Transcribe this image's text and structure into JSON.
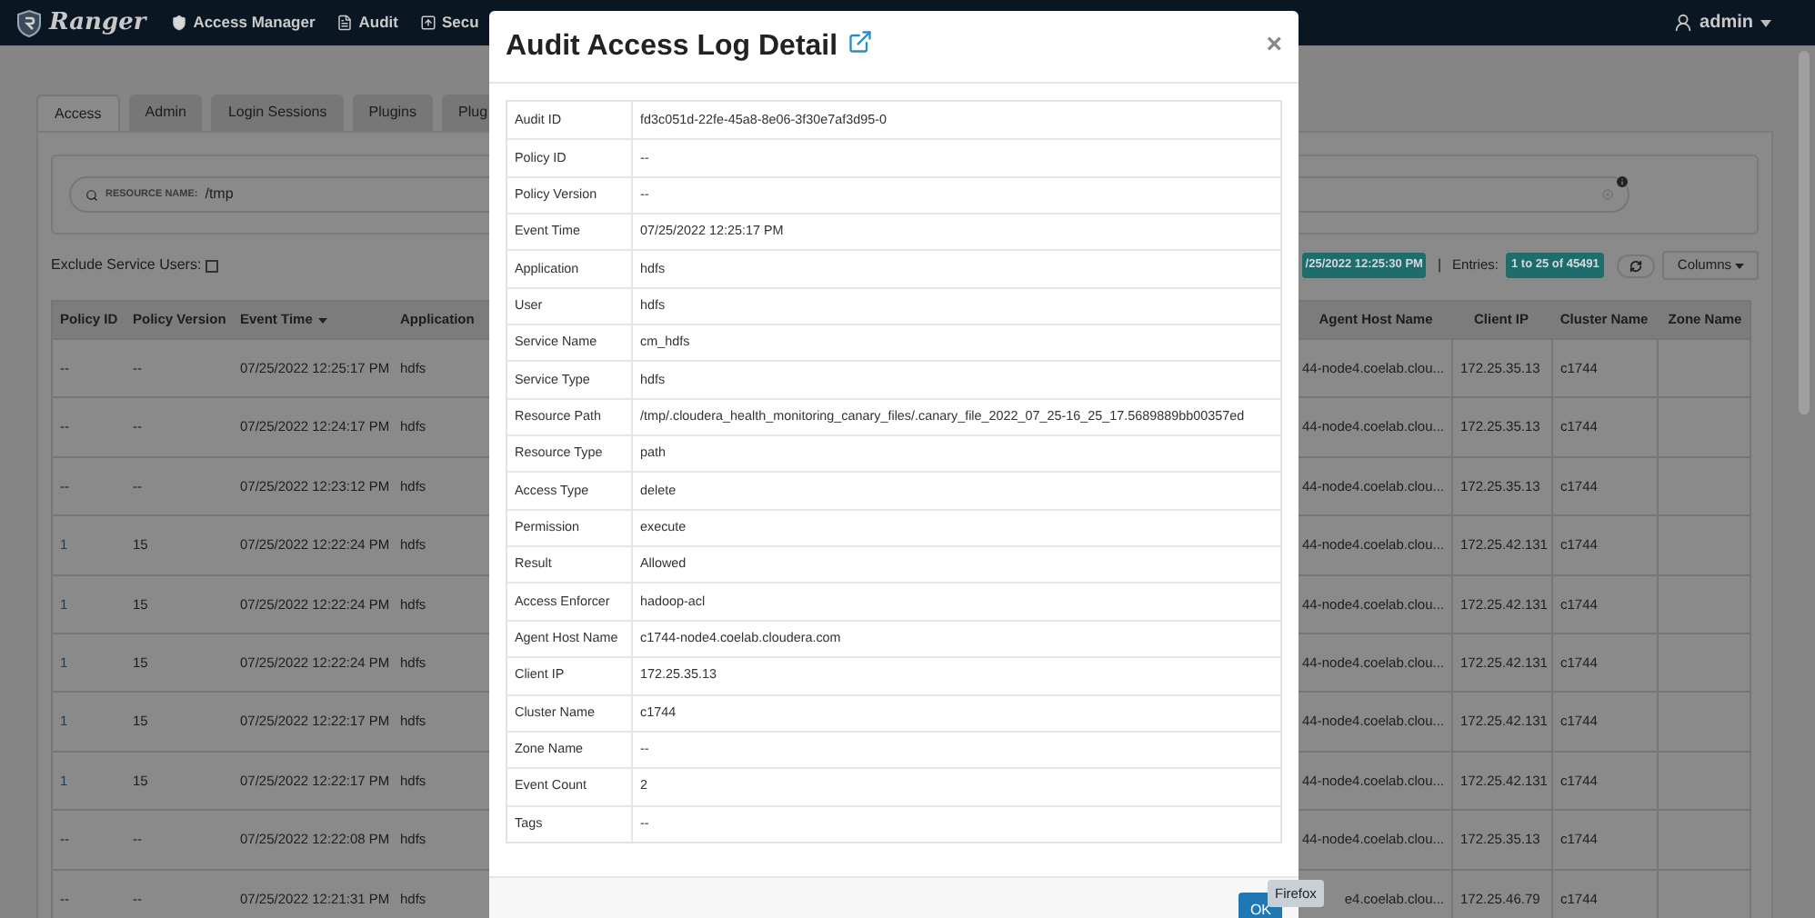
{
  "nav": {
    "brand": "Ranger",
    "items": [
      {
        "label": "Access Manager"
      },
      {
        "label": "Audit"
      },
      {
        "label": "Secu"
      }
    ],
    "user": "admin"
  },
  "tabs": [
    {
      "label": "Access",
      "selected": true
    },
    {
      "label": "Admin",
      "selected": false
    },
    {
      "label": "Login Sessions",
      "selected": false
    },
    {
      "label": "Plugins",
      "selected": false
    },
    {
      "label": "Plug",
      "selected": false
    }
  ],
  "search": {
    "facet": "RESOURCE NAME:",
    "value": "/tmp"
  },
  "exclude_service_users": {
    "label": "Exclude Service Users:",
    "checked": false
  },
  "toolbar": {
    "last_updated": "/25/2022 12:25:30 PM",
    "separator": "|",
    "entries_label": "Entries:",
    "entries": "1 to 25 of 45491",
    "columns_button": "Columns"
  },
  "table": {
    "left_columns": [
      "Policy ID",
      "Policy Version",
      "Event Time",
      "Application"
    ],
    "right_columns": [
      "Agent Host Name",
      "Client IP",
      "Cluster Name",
      "Zone Name"
    ],
    "rows": [
      {
        "policy_id": "--",
        "policy_link": false,
        "policy_version": "--",
        "event_time": "07/25/2022 12:25:17 PM",
        "application": "hdfs",
        "agent_host": "44-node4.coelab.clou...",
        "client_ip": "172.25.35.13",
        "cluster": "c1744"
      },
      {
        "policy_id": "--",
        "policy_link": false,
        "policy_version": "--",
        "event_time": "07/25/2022 12:24:17 PM",
        "application": "hdfs",
        "agent_host": "44-node4.coelab.clou...",
        "client_ip": "172.25.35.13",
        "cluster": "c1744"
      },
      {
        "policy_id": "--",
        "policy_link": false,
        "policy_version": "--",
        "event_time": "07/25/2022 12:23:12 PM",
        "application": "hdfs",
        "agent_host": "44-node4.coelab.clou...",
        "client_ip": "172.25.35.13",
        "cluster": "c1744"
      },
      {
        "policy_id": "1",
        "policy_link": true,
        "policy_version": "15",
        "event_time": "07/25/2022 12:22:24 PM",
        "application": "hdfs",
        "agent_host": "44-node4.coelab.clou...",
        "client_ip": "172.25.42.131",
        "cluster": "c1744"
      },
      {
        "policy_id": "1",
        "policy_link": true,
        "policy_version": "15",
        "event_time": "07/25/2022 12:22:24 PM",
        "application": "hdfs",
        "agent_host": "44-node4.coelab.clou...",
        "client_ip": "172.25.42.131",
        "cluster": "c1744"
      },
      {
        "policy_id": "1",
        "policy_link": true,
        "policy_version": "15",
        "event_time": "07/25/2022 12:22:24 PM",
        "application": "hdfs",
        "agent_host": "44-node4.coelab.clou...",
        "client_ip": "172.25.42.131",
        "cluster": "c1744"
      },
      {
        "policy_id": "1",
        "policy_link": true,
        "policy_version": "15",
        "event_time": "07/25/2022 12:22:17 PM",
        "application": "hdfs",
        "agent_host": "44-node4.coelab.clou...",
        "client_ip": "172.25.42.131",
        "cluster": "c1744"
      },
      {
        "policy_id": "1",
        "policy_link": true,
        "policy_version": "15",
        "event_time": "07/25/2022 12:22:17 PM",
        "application": "hdfs",
        "agent_host": "44-node4.coelab.clou...",
        "client_ip": "172.25.42.131",
        "cluster": "c1744"
      },
      {
        "policy_id": "--",
        "policy_link": false,
        "policy_version": "--",
        "event_time": "07/25/2022 12:22:08 PM",
        "application": "hdfs",
        "agent_host": "44-node4.coelab.clou...",
        "client_ip": "172.25.35.13",
        "cluster": "c1744"
      },
      {
        "policy_id": "--",
        "policy_link": false,
        "policy_version": "--",
        "event_time": "07/25/2022 12:21:31 PM",
        "application": "hdfs",
        "agent_host": "e4.coelab.clou...",
        "client_ip": "172.25.46.79",
        "cluster": "c1744"
      }
    ]
  },
  "modal": {
    "title": "Audit Access Log Detail",
    "close": "×",
    "fields": [
      {
        "label": "Audit ID",
        "value": "fd3c051d-22fe-45a8-8e06-3f30e7af3d95-0"
      },
      {
        "label": "Policy ID",
        "value": "--"
      },
      {
        "label": "Policy Version",
        "value": "--"
      },
      {
        "label": "Event Time",
        "value": "07/25/2022 12:25:17 PM"
      },
      {
        "label": "Application",
        "value": "hdfs"
      },
      {
        "label": "User",
        "value": "hdfs"
      },
      {
        "label": "Service Name",
        "value": "cm_hdfs"
      },
      {
        "label": "Service Type",
        "value": "hdfs"
      },
      {
        "label": "Resource Path",
        "value": "/tmp/.cloudera_health_monitoring_canary_files/.canary_file_2022_07_25-16_25_17.5689889bb00357ed"
      },
      {
        "label": "Resource Type",
        "value": "path"
      },
      {
        "label": "Access Type",
        "value": "delete"
      },
      {
        "label": "Permission",
        "value": "execute"
      },
      {
        "label": "Result",
        "value": "Allowed"
      },
      {
        "label": "Access Enforcer",
        "value": "hadoop-acl"
      },
      {
        "label": "Agent Host Name",
        "value": "c1744-node4.coelab.cloudera.com"
      },
      {
        "label": "Client IP",
        "value": "172.25.35.13"
      },
      {
        "label": "Cluster Name",
        "value": "c1744"
      },
      {
        "label": "Zone Name",
        "value": "--"
      },
      {
        "label": "Event Count",
        "value": "2"
      },
      {
        "label": "Tags",
        "value": "--"
      }
    ],
    "ok_button": "OK"
  },
  "tooltip": "Firefox"
}
